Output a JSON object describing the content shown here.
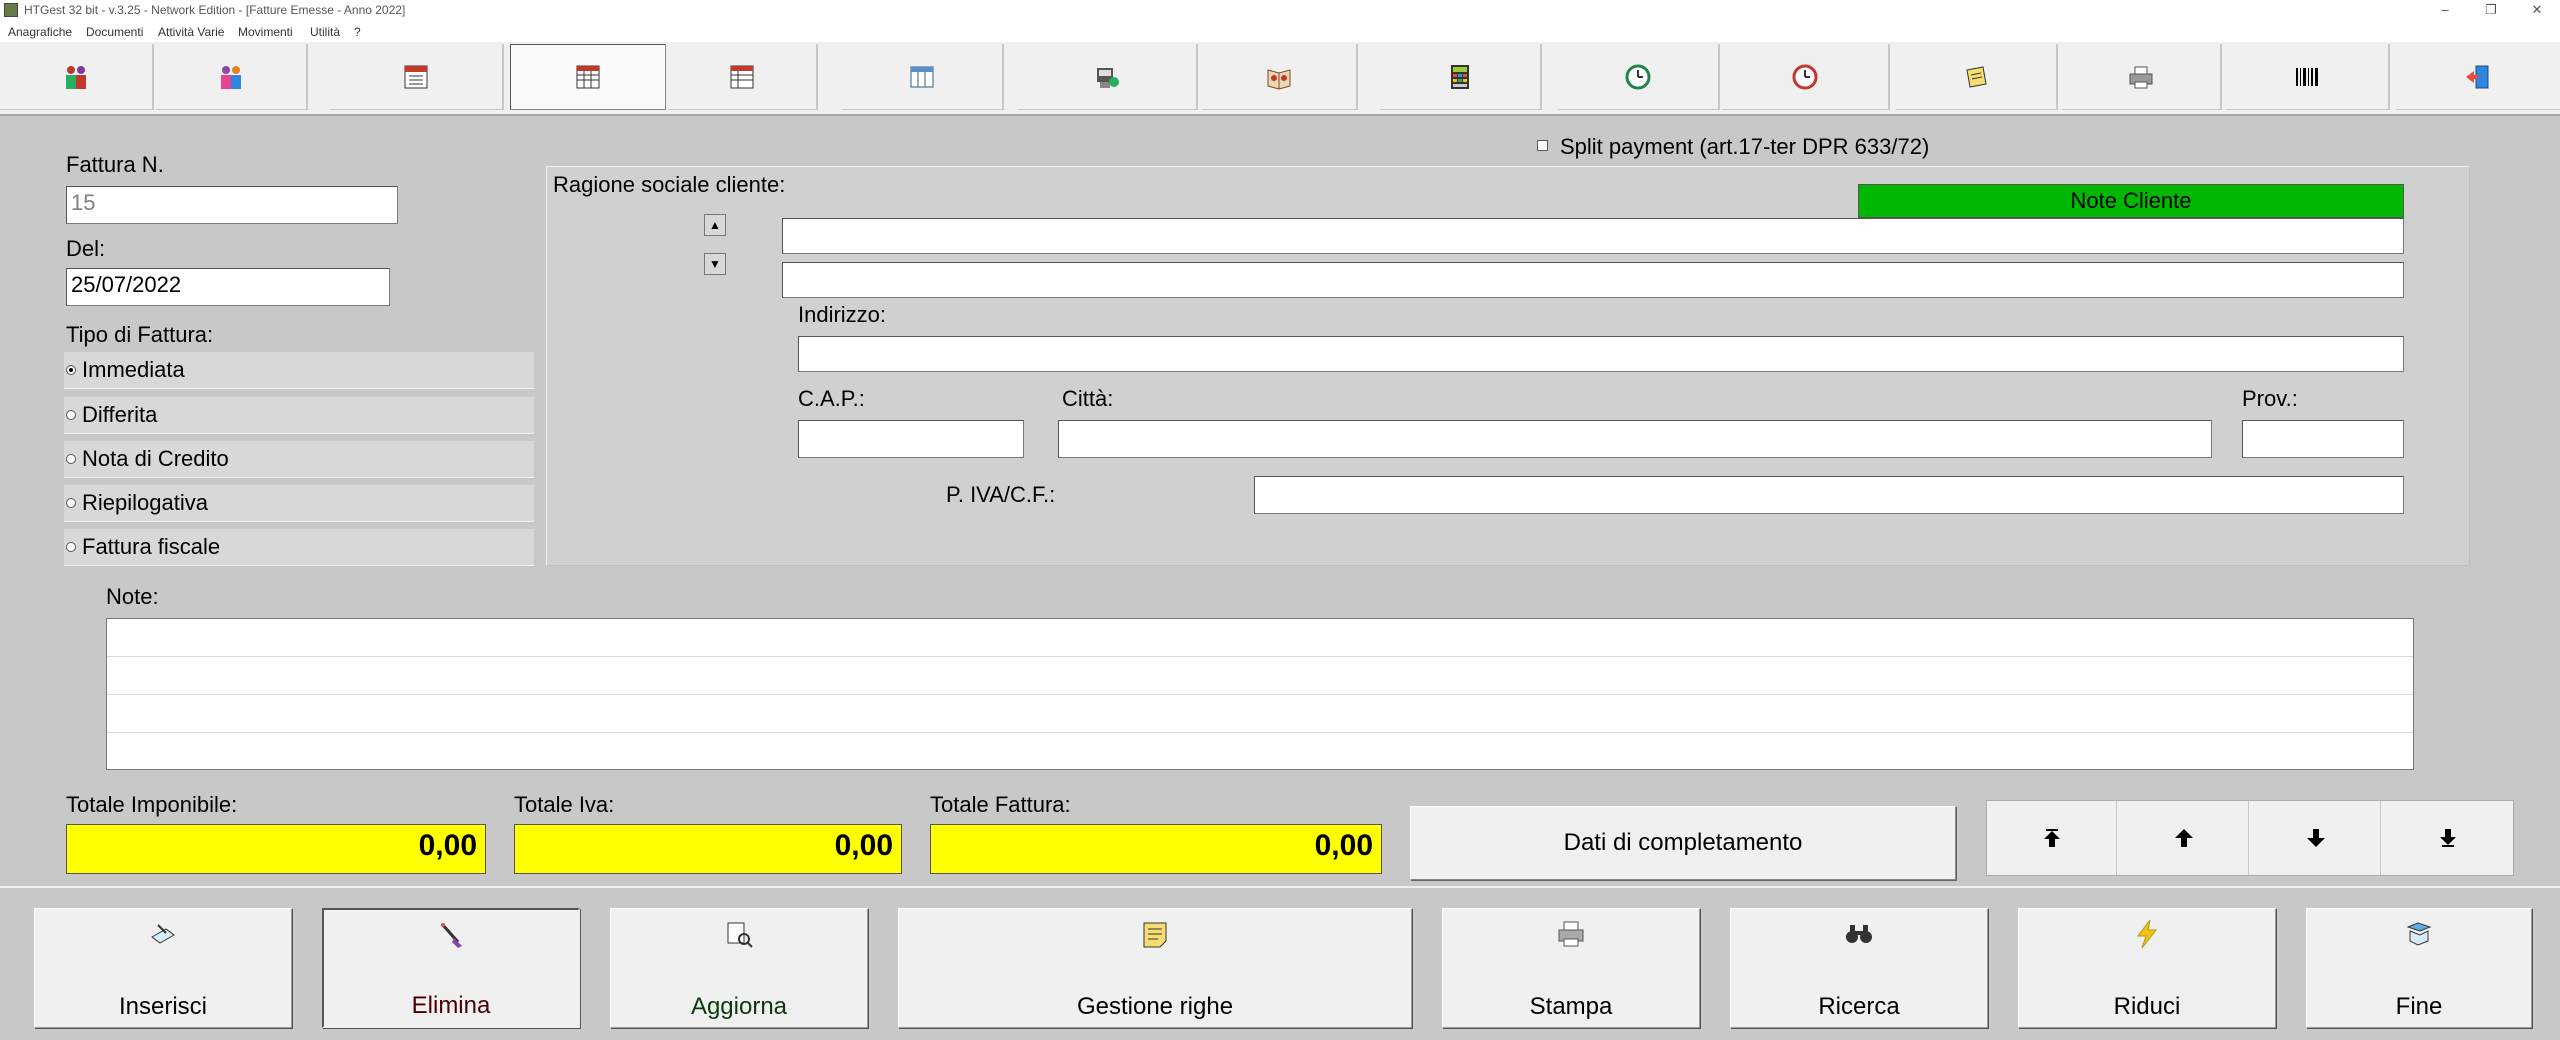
{
  "window": {
    "title": "HTGest 32 bit - v.3.25 - Network Edition - [Fatture Emesse - Anno 2022]",
    "minimize": "–",
    "maximize": "❐",
    "close": "✕"
  },
  "menu": [
    "Anagrafiche",
    "Documenti",
    "Attività Varie",
    "Movimenti",
    "Utilità",
    "?"
  ],
  "toolbar_icons": [
    "people-green-icon",
    "people-pink-icon",
    "calendar-icon",
    "invoice-grid-icon",
    "invoice-grid-alt-icon",
    "table-icon",
    "receipt-icon",
    "book-icon",
    "calculator-icon",
    "clock-green-icon",
    "clock-red-icon",
    "notepad-icon",
    "printer-icon",
    "barcode-icon",
    "exit-door-icon"
  ],
  "form": {
    "invoice_number_label": "Fattura N.",
    "invoice_number_value": "15",
    "date_label": "Del:",
    "date_value": "25/07/2022",
    "invoice_type_label": "Tipo di Fattura:",
    "invoice_types": [
      {
        "label": "Immediata",
        "selected": true
      },
      {
        "label": "Differita",
        "selected": false
      },
      {
        "label": "Nota di Credito",
        "selected": false
      },
      {
        "label": "Riepilogativa",
        "selected": false
      },
      {
        "label": "Fattura fiscale",
        "selected": false
      }
    ],
    "split_payment_label": "Split payment (art.17-ter DPR 633/72)",
    "client": {
      "name_label": "Ragione sociale cliente:",
      "note_cliente_label": "Note Cliente",
      "note_cliente_color": "#00b800",
      "address_label": "Indirizzo:",
      "cap_label": "C.A.P.:",
      "city_label": "Città:",
      "prov_label": "Prov.:",
      "piva_label": "P. IVA/C.F.:",
      "name_line1": "",
      "name_line2": "",
      "address": "",
      "cap": "",
      "city": "",
      "prov": "",
      "piva": ""
    },
    "notes_label": "Note:",
    "totals": {
      "imponibile_label": "Totale Imponibile:",
      "imponibile_value": "0,00",
      "iva_label": "Totale Iva:",
      "iva_value": "0,00",
      "fattura_label": "Totale Fattura:",
      "fattura_value": "0,00",
      "highlight_color": "#ffff00"
    },
    "completion_button": "Dati di completamento",
    "nav_icons": [
      "first-record-icon",
      "previous-record-icon",
      "next-record-icon",
      "last-record-icon"
    ]
  },
  "actions": [
    {
      "label": "Inserisci",
      "icon": "insert-pen-icon"
    },
    {
      "label": "Elimina",
      "icon": "delete-brush-icon"
    },
    {
      "label": "Aggiorna",
      "icon": "update-book-icon"
    },
    {
      "label": "Gestione righe",
      "icon": "notepad-icon"
    },
    {
      "label": "Stampa",
      "icon": "printer-icon"
    },
    {
      "label": "Ricerca",
      "icon": "binoculars-icon"
    },
    {
      "label": "Riduci",
      "icon": "lightning-icon"
    },
    {
      "label": "Fine",
      "icon": "exit-icon"
    }
  ]
}
